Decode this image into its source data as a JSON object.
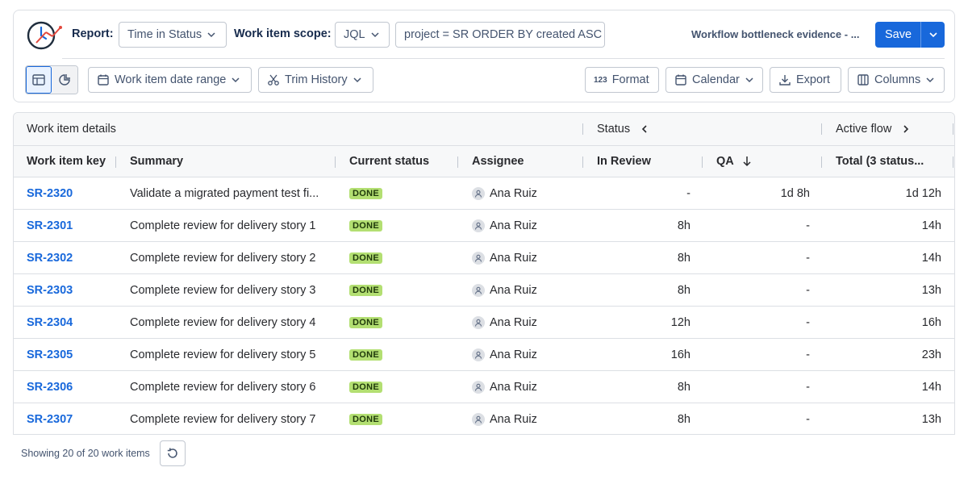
{
  "toolbar": {
    "report_label": "Report:",
    "report_value": "Time in Status",
    "scope_label": "Work item scope:",
    "scope_value": "JQL",
    "jql_query": "project = SR ORDER BY created ASC",
    "report_name": "Workflow bottleneck evidence - ...",
    "save_label": "Save",
    "date_range_label": "Work item date range",
    "trim_history_label": "Trim History",
    "format_label": "Format",
    "calendar_label": "Calendar",
    "export_label": "Export",
    "columns_label": "Columns"
  },
  "table": {
    "groups": {
      "details": "Work item details",
      "status": "Status",
      "active_flow": "Active flow"
    },
    "headers": {
      "key": "Work item key",
      "summary": "Summary",
      "current_status": "Current status",
      "assignee": "Assignee",
      "in_review": "In Review",
      "qa": "QA",
      "total": "Total (3 status..."
    },
    "rows": [
      {
        "key": "SR-2320",
        "summary": "Validate a migrated payment test fi...",
        "status": "DONE",
        "assignee": "Ana Ruiz",
        "in_review": "-",
        "qa": "1d 8h",
        "total": "1d 12h"
      },
      {
        "key": "SR-2301",
        "summary": "Complete review for delivery story 1",
        "status": "DONE",
        "assignee": "Ana Ruiz",
        "in_review": "8h",
        "qa": "-",
        "total": "14h"
      },
      {
        "key": "SR-2302",
        "summary": "Complete review for delivery story 2",
        "status": "DONE",
        "assignee": "Ana Ruiz",
        "in_review": "8h",
        "qa": "-",
        "total": "14h"
      },
      {
        "key": "SR-2303",
        "summary": "Complete review for delivery story 3",
        "status": "DONE",
        "assignee": "Ana Ruiz",
        "in_review": "8h",
        "qa": "-",
        "total": "13h"
      },
      {
        "key": "SR-2304",
        "summary": "Complete review for delivery story 4",
        "status": "DONE",
        "assignee": "Ana Ruiz",
        "in_review": "12h",
        "qa": "-",
        "total": "16h"
      },
      {
        "key": "SR-2305",
        "summary": "Complete review for delivery story 5",
        "status": "DONE",
        "assignee": "Ana Ruiz",
        "in_review": "16h",
        "qa": "-",
        "total": "23h"
      },
      {
        "key": "SR-2306",
        "summary": "Complete review for delivery story 6",
        "status": "DONE",
        "assignee": "Ana Ruiz",
        "in_review": "8h",
        "qa": "-",
        "total": "14h"
      },
      {
        "key": "SR-2307",
        "summary": "Complete review for delivery story 7",
        "status": "DONE",
        "assignee": "Ana Ruiz",
        "in_review": "8h",
        "qa": "-",
        "total": "13h"
      }
    ]
  },
  "footer": {
    "showing_text": "Showing 20 of 20 work items"
  },
  "colors": {
    "accent": "#1868db",
    "done_lozenge": "#b3df72"
  }
}
